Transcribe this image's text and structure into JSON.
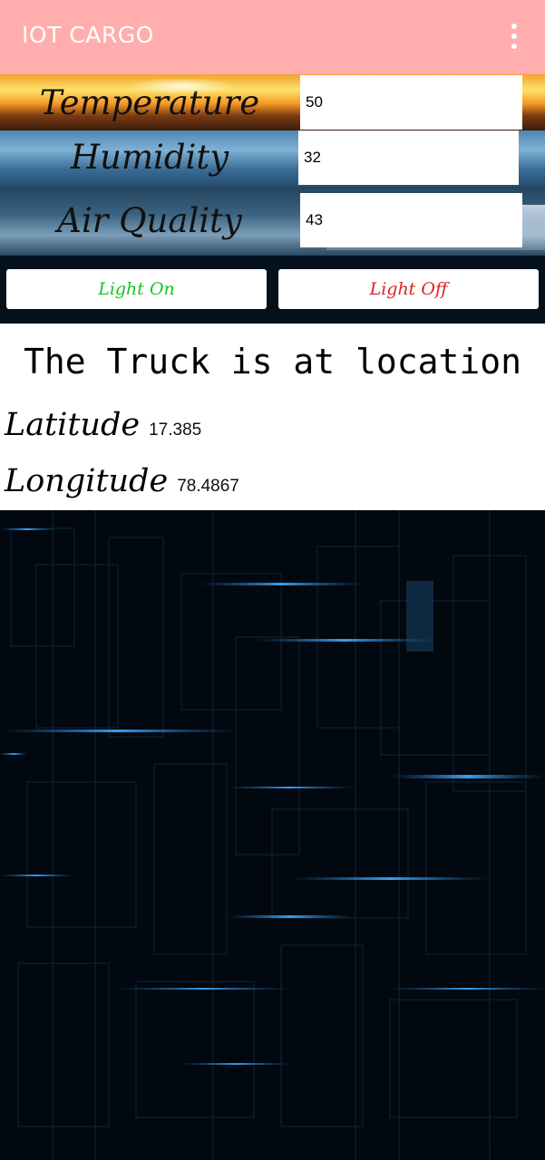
{
  "app_bar": {
    "title": "IOT CARGO",
    "menu_icon": "overflow-menu-icon",
    "background_color": "#ffadad"
  },
  "sensors": [
    {
      "label": "Temperature",
      "value": "50"
    },
    {
      "label": "Humidity",
      "value": "32"
    },
    {
      "label": "Air Quality",
      "value": "43"
    }
  ],
  "light_controls": {
    "on_label": "Light On",
    "off_label": "Light Off",
    "on_color": "#17c422",
    "off_color": "#e02020"
  },
  "location": {
    "heading": "The Truck is at location",
    "latitude_label": "Latitude",
    "latitude_value": "17.385",
    "longitude_label": "Longitude",
    "longitude_value": "78.4867"
  }
}
